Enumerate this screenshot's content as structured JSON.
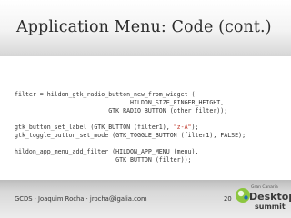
{
  "slide": {
    "title": "Application Menu: Code (cont.)",
    "code": {
      "l1a": "filter = hildon_gtk_radio_button_new_from_widget (",
      "l2": "                                HILDON_SIZE_FINGER_HEIGHT,",
      "l3": "                          GTK_RADIO_BUTTON (other_filter));",
      "l5a": "gtk_button_set_label (GTK_BUTTON (filter1), ",
      "l5str": "\"z-A\"",
      "l5b": ");",
      "l6": "gtk_toggle_button_set_mode (GTK_TOGGLE_BUTTON (filter1), FALSE);",
      "l8": "hildon_app_menu_add_filter (HILDON_APP_MENU (menu),",
      "l9": "                            GTK_BUTTON (filter));"
    },
    "footer": {
      "credit": "GCDS · Joaquim Rocha · jrocha@igalia.com",
      "page_number": "20"
    },
    "logo": {
      "line1": "Gran Canaria",
      "line2": "Desktop",
      "line3": "summit"
    }
  }
}
